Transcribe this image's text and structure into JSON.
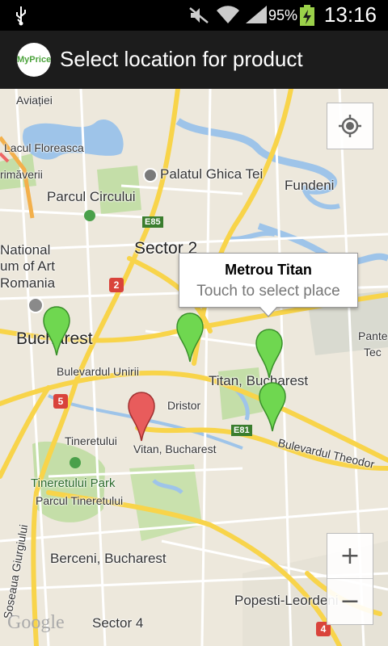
{
  "status": {
    "battery": "95%",
    "time": "13:16"
  },
  "app": {
    "logo_text": "MyPrice",
    "title": "Select location for product"
  },
  "popup": {
    "title": "Metrou Titan",
    "subtitle": "Touch to select place"
  },
  "map_labels": {
    "aviatiei": "Aviației",
    "lacul_floreasca": "Lacul Floreasca",
    "primaverii": "rimăverii",
    "palatul": "Palatul Ghica Tei",
    "fundeni": "Fundeni",
    "parcul_circului": "Parcul Circului",
    "e85": "E85",
    "sector2": "Sector 2",
    "national": "National",
    "um_of_art": "um of Art",
    "romania": "Romania",
    "bucharest": "Bucharest",
    "bulevardul_unirii": "Bulevardul Unirii",
    "pante": "Pante",
    "tec": "Tec",
    "titan": "Titan, Bucharest",
    "dristor": "Dristor",
    "tineretului": "Tineretului",
    "vitan": "Vitan, Bucharest",
    "e81": "E81",
    "bd_theodor": "Bulevardul Theodor",
    "tineretului_park": "Tineretului Park",
    "parcul_tineretului": "Parcul Tineretului",
    "soseaua": "Șoseaua Giurgiului",
    "berceni": "Berceni, Bucharest",
    "popesti": "Popesti-Leordeni",
    "sector4": "Sector 4",
    "google": "Google"
  },
  "shields": {
    "r2": "2",
    "r5": "5",
    "r4": "4"
  },
  "zoom": {
    "in": "+",
    "out": "−"
  },
  "colors": {
    "marker_green": "#6fd750",
    "marker_red": "#e85c5c",
    "road_yellow": "#f8d44a",
    "water": "#9ec4e9",
    "park": "#c4dea8"
  }
}
